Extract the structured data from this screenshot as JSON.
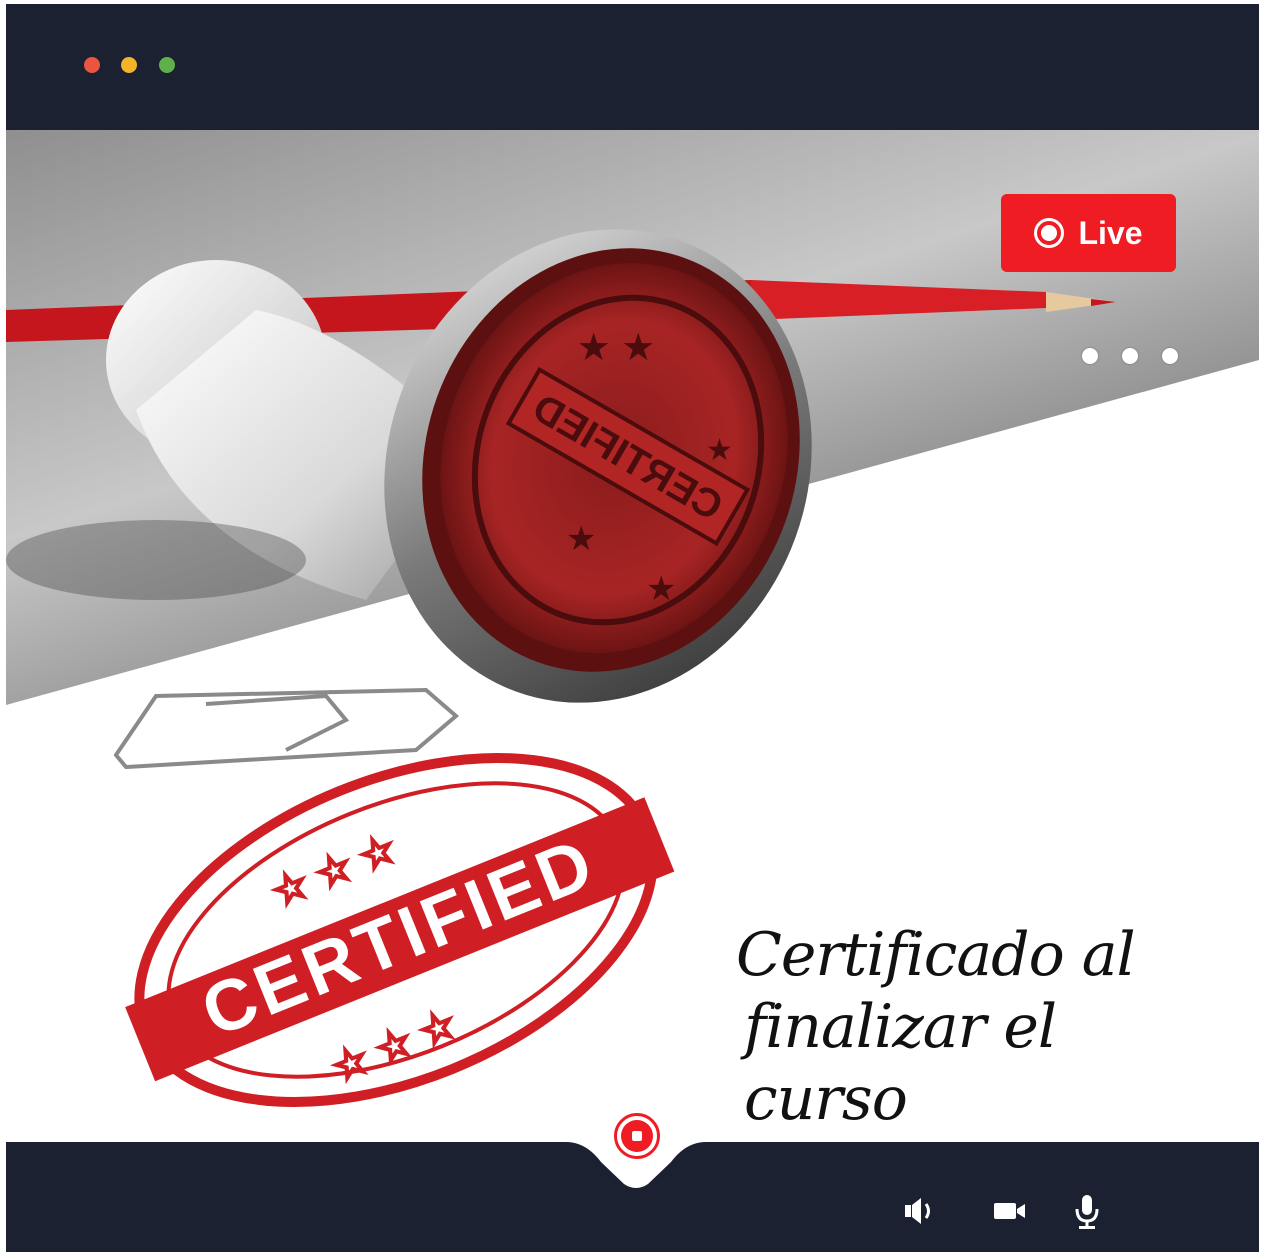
{
  "window": {
    "controls": [
      "close",
      "minimize",
      "maximize"
    ],
    "colors": {
      "close": "#e9553f",
      "minimize": "#f3b42a",
      "maximize": "#5fb04a",
      "bar": "#1b2130"
    }
  },
  "stream": {
    "live_label": "Live",
    "live_color": "#ef1c24",
    "more_icon": "more-dots-icon"
  },
  "image": {
    "stamp_text": "CERTIFIED",
    "caption_line1": "Certificado al",
    "caption_line2": "finalizar el curso"
  },
  "controls": {
    "record_icon": "record-stop-icon",
    "speaker_icon": "speaker-icon",
    "camera_icon": "video-camera-icon",
    "mic_icon": "microphone-icon"
  }
}
